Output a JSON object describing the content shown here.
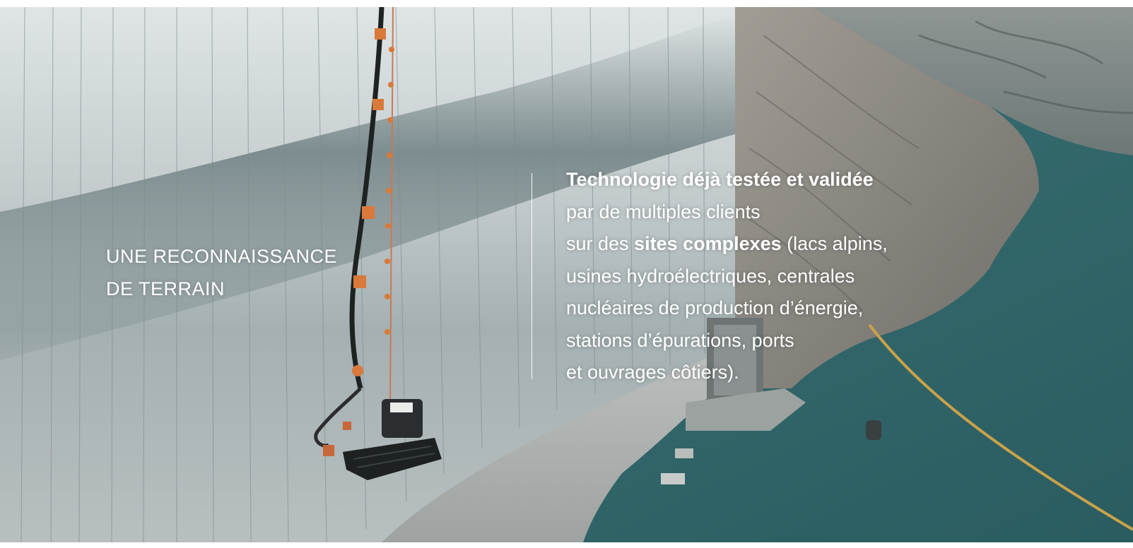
{
  "hero": {
    "left_heading": {
      "line1": "UNE RECONNAISSANCE",
      "line2": "DE TERRAIN"
    },
    "right_text": {
      "line1_bold": "Technologie déjà testée et validée",
      "line2": "par de multiples clients",
      "line3_prefix": "sur des ",
      "line3_bold": "sites complexes",
      "line3_suffix": " (lacs alpins,",
      "line4": "usines hydroélectriques, centrales",
      "line5": "nucléaires de production d’énergie,",
      "line6": "stations d’épurations, ports",
      "line7": "et ouvrages côtiers)."
    }
  },
  "colors": {
    "text": "#ffffff",
    "dam_wall": "#c9d0d2",
    "water": "#2f5f64",
    "rock": "#8d8a84",
    "accent_orange": "#d9793a"
  }
}
